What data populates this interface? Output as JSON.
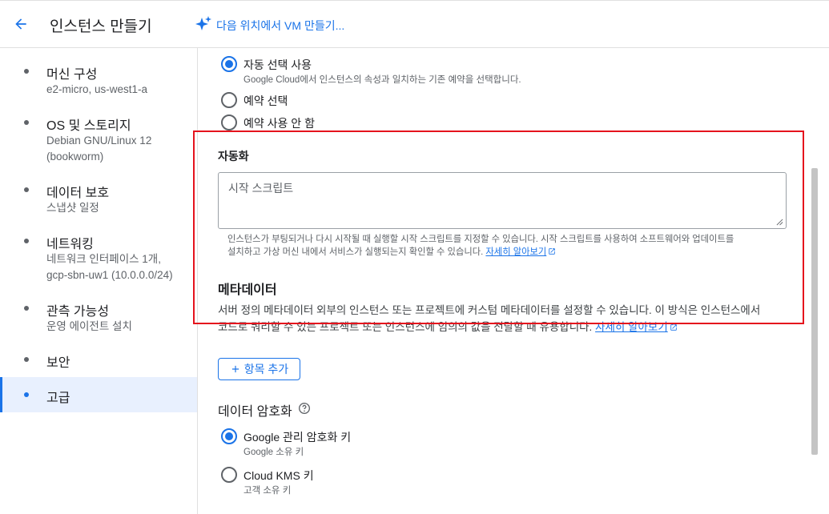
{
  "header": {
    "title": "인스턴스 만들기",
    "vm_link": "다음 위치에서 VM 만들기..."
  },
  "sidebar": {
    "items": [
      {
        "title": "머신 구성",
        "sub": [
          "e2-micro, us-west1-a"
        ]
      },
      {
        "title": "OS 및 스토리지",
        "sub": [
          "Debian GNU/Linux 12",
          "(bookworm)"
        ]
      },
      {
        "title": "데이터 보호",
        "sub": [
          "스냅샷 일정"
        ]
      },
      {
        "title": "네트워킹",
        "sub": [
          "네트워크 인터페이스 1개,",
          "gcp-sbn-uw1 (10.0.0.0/24)"
        ]
      },
      {
        "title": "관측 가능성",
        "sub": [
          "운영 에이전트 설치"
        ]
      },
      {
        "title": "보안",
        "sub": []
      },
      {
        "title": "고급",
        "sub": []
      }
    ],
    "active": "고급"
  },
  "reservation": {
    "options": [
      {
        "label": "자동 선택 사용",
        "sub": "Google Cloud에서 인스턴스의 속성과 일치하는 기존 예약을 선택합니다.",
        "checked": true
      },
      {
        "label": "예약 선택",
        "checked": false
      },
      {
        "label": "예약 사용 안 함",
        "checked": false
      }
    ]
  },
  "automation": {
    "title": "자동화",
    "startup_placeholder": "시작 스크립트",
    "helper_line1": "인스턴스가 부팅되거나 다시 시작될 때 실행할 시작 스크립트를 지정할 수 있습니다. 시작 스크립트를 사용하여 소프트웨어와 업데이트를",
    "helper_line2": "설치하고 가상 머신 내에서 서비스가 실행되는지 확인할 수 있습니다.",
    "learn_more": "자세히 알아보기"
  },
  "metadata": {
    "title": "메타데이터",
    "desc_line1": "서버 정의 메타데이터 외부의 인스턴스 또는 프로젝트에 커스텀 메타데이터를 설정할 수 있습니다. 이 방식은 인스턴스에서",
    "desc_line2": "코드로 쿼리할 수 있는 프로젝트 또는 인스턴스에 임의의 값을 전달할 때 유용합니다.",
    "learn_more": "자세히 알아보기",
    "add_item": "항목 추가"
  },
  "encryption": {
    "title": "데이터 암호화",
    "options": [
      {
        "label": "Google 관리 암호화 키",
        "sub": "Google 소유 키",
        "checked": true
      },
      {
        "label": "Cloud KMS 키",
        "sub": "고객 소유 키",
        "checked": false
      }
    ]
  },
  "colors": {
    "accent": "#1a73e8",
    "highlight_border": "#e5131d",
    "active_nav_bg": "#e8f0fe"
  },
  "icons": {
    "back": "arrow-left-icon",
    "sparkle": "sparkle-icon",
    "help": "help-circle-icon",
    "external": "open-in-new-icon",
    "add": "plus-icon"
  }
}
